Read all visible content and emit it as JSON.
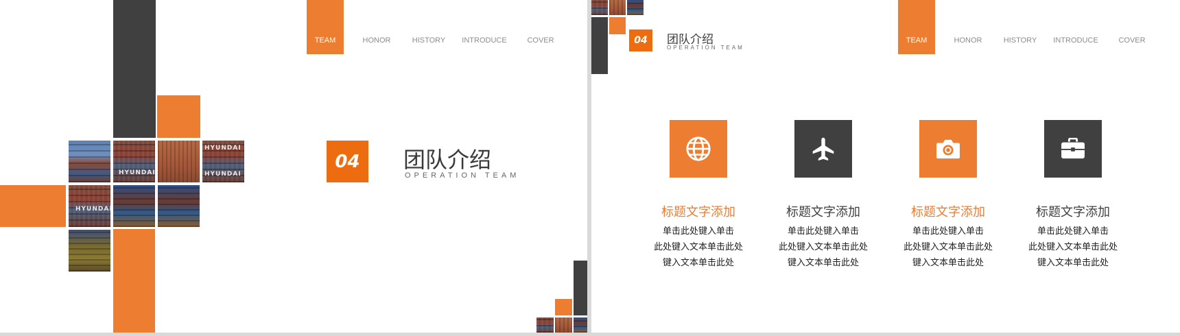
{
  "colors": {
    "accent": "#ed7d31",
    "dark": "#404040",
    "number_box": "#ed6c0f"
  },
  "nav": [
    "TEAM",
    "HONOR",
    "HISTORY",
    "INTRODUCE",
    "COVER"
  ],
  "section": {
    "number": "04",
    "title_cn": "团队介绍",
    "title_en": "OPERATION TEAM"
  },
  "photo_labels": {
    "hyundai": "HYUNDAI"
  },
  "cards": [
    {
      "icon": "globe-icon",
      "title": "标题文字添加",
      "title_color": "#ed7d31",
      "lines": [
        "单击此处键入单击",
        "此处键入文本单击此处",
        "键入文本单击此处"
      ]
    },
    {
      "icon": "airplane-icon",
      "title": "标题文字添加",
      "title_color": "#404040",
      "lines": [
        "单击此处键入单击",
        "此处键入文本单击此处",
        "键入文本单击此处"
      ]
    },
    {
      "icon": "camera-icon",
      "title": "标题文字添加",
      "title_color": "#ed7d31",
      "lines": [
        "单击此处键入单击",
        "此处键入文本单击此处",
        "键入文本单击此处"
      ]
    },
    {
      "icon": "briefcase-icon",
      "title": "标题文字添加",
      "title_color": "#404040",
      "lines": [
        "单击此处键入单击",
        "此处键入文本单击此处",
        "键入文本单击此处"
      ]
    }
  ]
}
